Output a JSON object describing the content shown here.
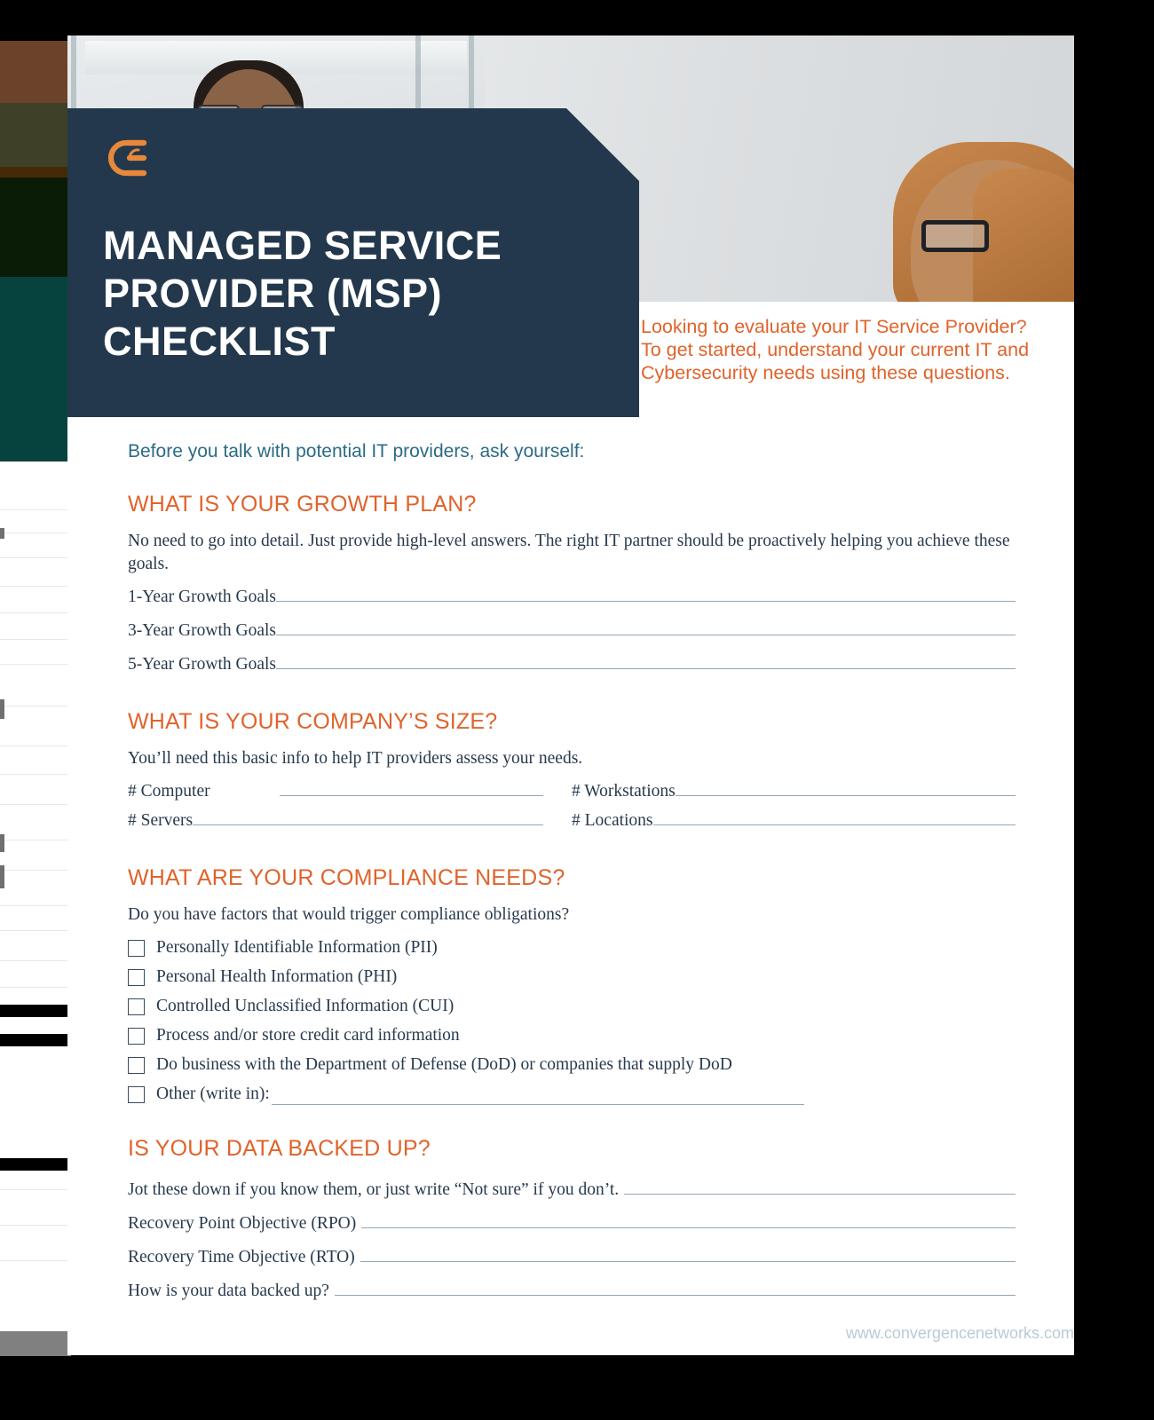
{
  "brand": {
    "logo_icon": "convergence-logo-icon",
    "navy": "#23384c",
    "orange": "#e0632b",
    "teal": "#2b6b86",
    "rule": "#93a7b5"
  },
  "header": {
    "title": "MANAGED SERVICE PROVIDER (MSP) CHECKLIST",
    "intro": "Looking to evaluate your IT Service Provider? To get started, understand your current IT and Cybersecurity needs using these questions.",
    "photo_alt": "office-meeting-photo"
  },
  "body": {
    "lead": "Before you talk with potential IT providers, ask yourself:",
    "sections": [
      {
        "heading": "WHAT IS YOUR GROWTH PLAN?",
        "note": "No need to go into detail. Just provide high-level answers. The right IT partner should be proactively helping you achieve these goals.",
        "fields": [
          "1-Year Growth Goals",
          "3-Year Growth Goals",
          "5-Year Growth Goals"
        ]
      },
      {
        "heading": "WHAT IS YOUR COMPANY’S SIZE?",
        "note": "You’ll need this basic info to help IT providers assess your needs.",
        "field_pairs": [
          [
            "# Computer",
            "# Workstations"
          ],
          [
            "# Servers",
            "# Locations"
          ]
        ]
      },
      {
        "heading": "WHAT ARE YOUR COMPLIANCE NEEDS?",
        "note": "Do you have factors that would trigger compliance obligations?",
        "checkboxes": [
          "Personally Identifiable Information (PII)",
          "Personal Health Information (PHI)",
          "Controlled Unclassified Information (CUI)",
          "Process and/or store credit card information",
          "Do business with the Department of Defense (DoD) or companies that supply DoD"
        ],
        "other_label": "Other (write in):"
      },
      {
        "heading": "IS YOUR DATA BACKED UP?",
        "fields": [
          "Jot these down if you know them, or just write “Not sure” if you don’t.",
          "Recovery Point Objective (RPO)",
          "Recovery Time Objective (RTO)",
          "How is your data backed up?"
        ]
      }
    ]
  },
  "footer": {
    "url": "www.convergencenetworks.com"
  }
}
